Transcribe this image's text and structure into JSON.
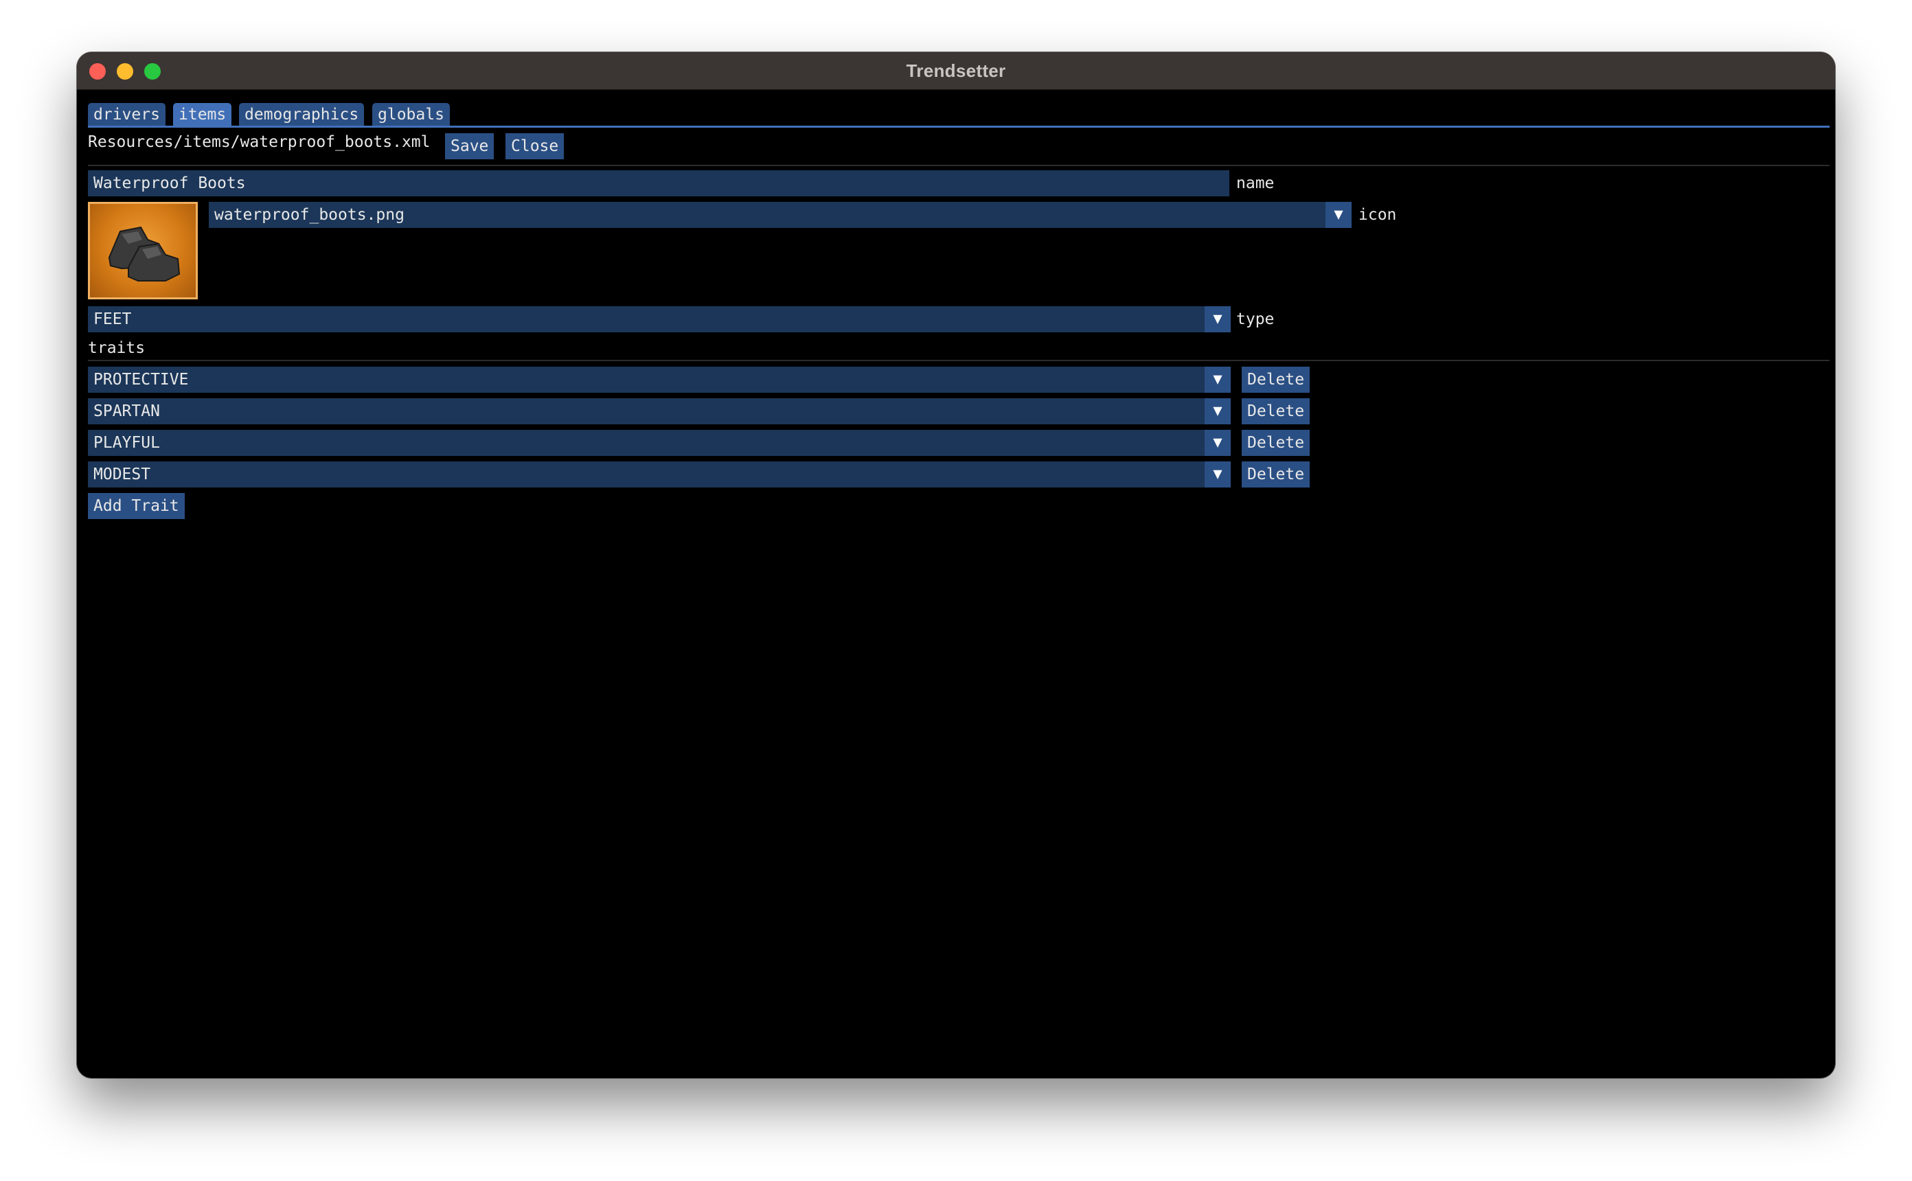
{
  "window": {
    "title": "Trendsetter"
  },
  "tabs": [
    {
      "label": "drivers",
      "active": false
    },
    {
      "label": "items",
      "active": true
    },
    {
      "label": "demographics",
      "active": false
    },
    {
      "label": "globals",
      "active": false
    }
  ],
  "file": {
    "path": "Resources/items/waterproof_boots.xml",
    "save_label": "Save",
    "close_label": "Close"
  },
  "item": {
    "name_value": "Waterproof Boots",
    "name_label": "name",
    "icon_value": "waterproof_boots.png",
    "icon_label": "icon",
    "icon_image": "boots-icon",
    "type_value": "FEET",
    "type_label": "type"
  },
  "traits": {
    "heading": "traits",
    "items": [
      {
        "value": "PROTECTIVE",
        "delete_label": "Delete"
      },
      {
        "value": "SPARTAN",
        "delete_label": "Delete"
      },
      {
        "value": "PLAYFUL",
        "delete_label": "Delete"
      },
      {
        "value": "MODEST",
        "delete_label": "Delete"
      }
    ],
    "add_label": "Add Trait"
  },
  "glyphs": {
    "dropdown": "▼"
  },
  "colors": {
    "tab_active": "#4170b8",
    "tab_inactive": "#2a4f84",
    "field_bg": "#1b3658",
    "button_bg": "#2a4f84",
    "background": "#000000",
    "titlebar": "#3b3533"
  }
}
